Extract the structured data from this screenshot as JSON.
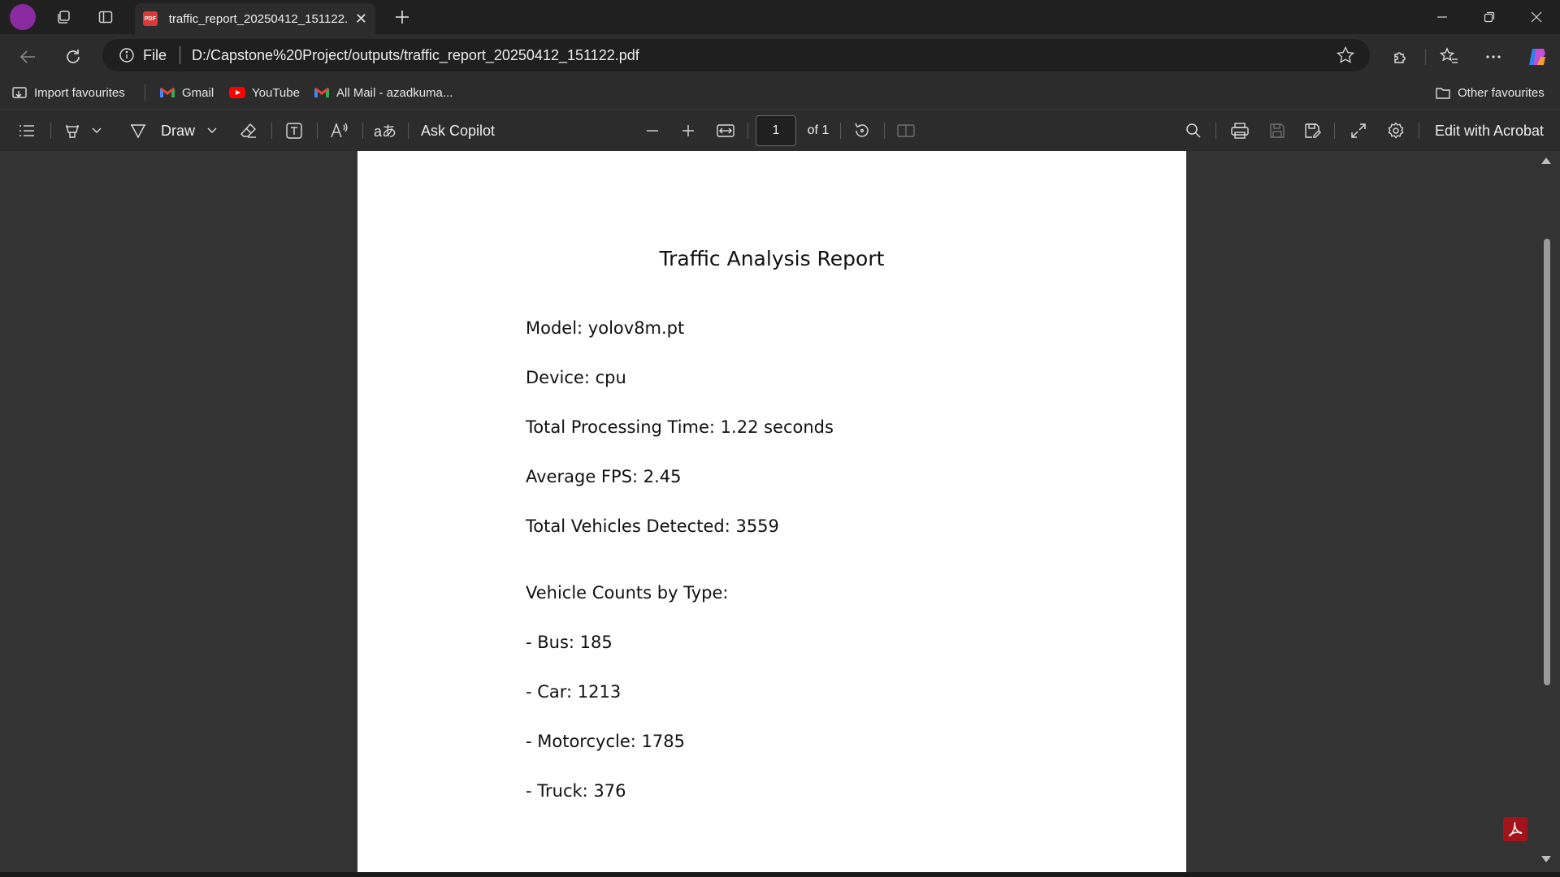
{
  "tab": {
    "title": "traffic_report_20250412_151122.pdf",
    "pdf_badge": "PDF"
  },
  "address": {
    "scheme_label": "File",
    "url": "D:/Capstone%20Project/outputs/traffic_report_20250412_151122.pdf"
  },
  "bookmarks": {
    "import": "Import favourites",
    "items": [
      "Gmail",
      "YouTube",
      "All Mail - azadkuma..."
    ],
    "other": "Other favourites"
  },
  "pdf_toolbar": {
    "draw_label": "Draw",
    "copilot_label": "Ask Copilot",
    "page_current": "1",
    "page_total": "of 1",
    "acrobat_label": "Edit with Acrobat"
  },
  "document": {
    "title": "Traffic Analysis Report",
    "lines": [
      "Model: yolov8m.pt",
      "Device: cpu",
      "Total Processing Time: 1.22 seconds",
      "Average FPS: 2.45",
      "Total Vehicles Detected: 3559",
      "Vehicle Counts by Type:",
      "- Bus: 185",
      "- Car: 1213",
      "- Motorcycle: 1785",
      "- Truck: 376"
    ]
  },
  "colors": {
    "profile": "#8a2aa0",
    "pdf_red": "#d83a3a",
    "acrobat_red": "#a3141a",
    "youtube_red": "#ff0000"
  }
}
